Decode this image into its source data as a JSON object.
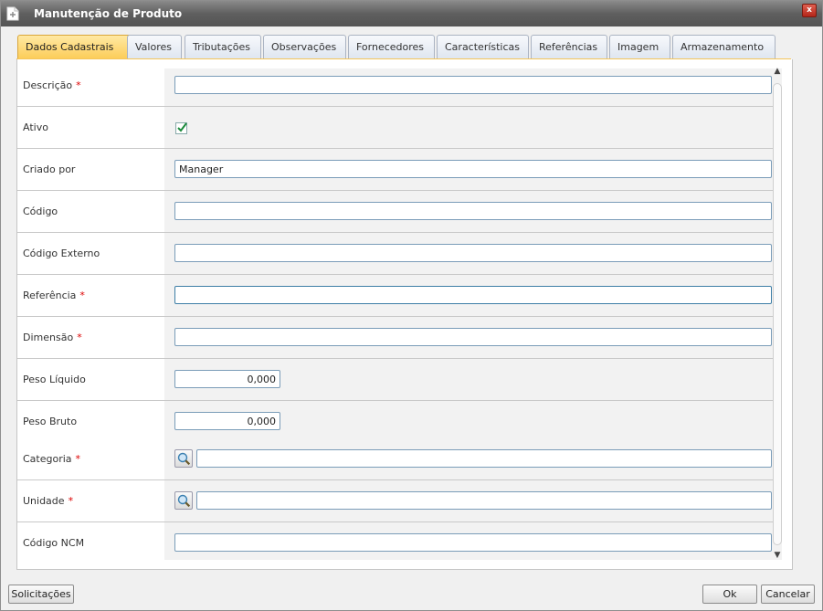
{
  "window": {
    "title": "Manutenção de Produto",
    "close_label": "x"
  },
  "tabs": [
    {
      "label": "Dados Cadastrais",
      "active": true
    },
    {
      "label": "Valores"
    },
    {
      "label": "Tributações"
    },
    {
      "label": "Observações"
    },
    {
      "label": "Fornecedores"
    },
    {
      "label": "Características"
    },
    {
      "label": "Referências"
    },
    {
      "label": "Imagem"
    },
    {
      "label": "Armazenamento"
    }
  ],
  "form": {
    "descricao": {
      "label": "Descrição",
      "required": "*",
      "value": ""
    },
    "ativo": {
      "label": "Ativo",
      "checked": true
    },
    "criado_por": {
      "label": "Criado por",
      "value": "Manager"
    },
    "codigo": {
      "label": "Código",
      "value": ""
    },
    "codigo_externo": {
      "label": "Código Externo",
      "value": ""
    },
    "referencia": {
      "label": "Referência",
      "required": "*",
      "value": ""
    },
    "dimensao": {
      "label": "Dimensão",
      "required": "*",
      "value": ""
    },
    "peso_liquido": {
      "label": "Peso Líquido",
      "value": "0,000"
    },
    "peso_bruto": {
      "label": "Peso Bruto",
      "value": "0,000"
    },
    "categoria": {
      "label": "Categoria",
      "required": "*",
      "value": ""
    },
    "unidade": {
      "label": "Unidade",
      "required": "*",
      "value": ""
    },
    "codigo_ncm": {
      "label": "Código NCM",
      "value": ""
    }
  },
  "footer": {
    "solicitacoes": "Solicitações",
    "ok": "Ok",
    "cancelar": "Cancelar"
  },
  "colors": {
    "active_tab": "#fccd5a",
    "required": "#dd0000",
    "title_bar": "#5f5f5f"
  }
}
